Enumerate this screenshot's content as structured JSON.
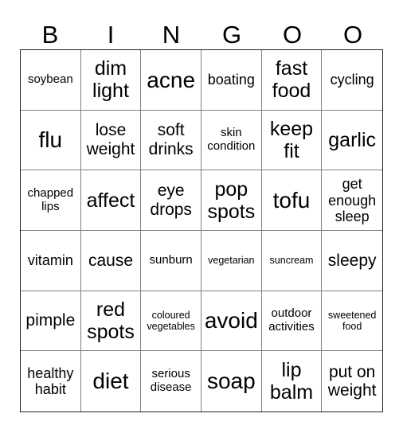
{
  "header": [
    "B",
    "I",
    "N",
    "G",
    "O",
    "O"
  ],
  "cells": [
    [
      "soybean",
      "dim light",
      "acne",
      "boating",
      "fast food",
      "cycling"
    ],
    [
      "flu",
      "lose weight",
      "soft drinks",
      "skin condition",
      "keep fit",
      "garlic"
    ],
    [
      "chapped lips",
      "affect",
      "eye drops",
      "pop spots",
      "tofu",
      "get enough sleep"
    ],
    [
      "vitamin",
      "cause",
      "sunburn",
      "vegetarian",
      "suncream",
      "sleepy"
    ],
    [
      "pimple",
      "red spots",
      "coloured vegetables",
      "avoid",
      "outdoor activities",
      "sweetened food"
    ],
    [
      "healthy habit",
      "diet",
      "serious disease",
      "soap",
      "lip balm",
      "put on weight"
    ]
  ]
}
